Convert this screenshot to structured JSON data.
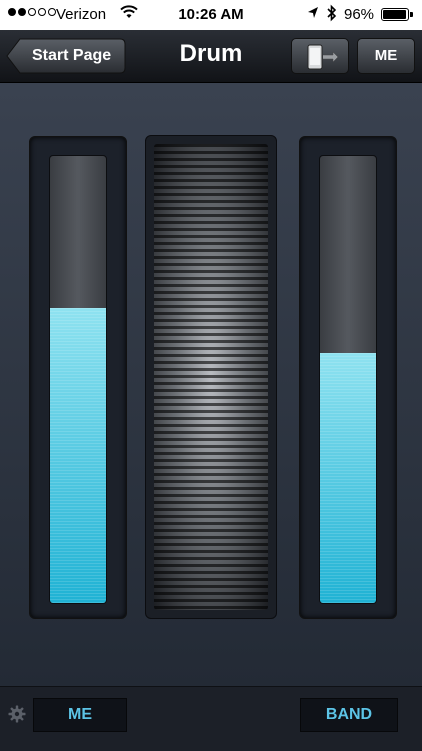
{
  "status_bar": {
    "carrier": "Verizon",
    "time": "10:26 AM",
    "battery": "96%",
    "battery_level": 0.96,
    "signal_bars_filled": 2,
    "signal_bars_total": 5
  },
  "nav": {
    "back_label": "Start Page",
    "title": "Drum",
    "right_button_label": "ME"
  },
  "controls": {
    "left_level": 0.66,
    "right_level": 0.56
  },
  "bottom": {
    "me_label": "ME",
    "band_label": "BAND"
  },
  "colors": {
    "accent": "#5cc4e6",
    "fill_top": "#8fe2f0",
    "fill_bottom": "#1fb2d4"
  }
}
